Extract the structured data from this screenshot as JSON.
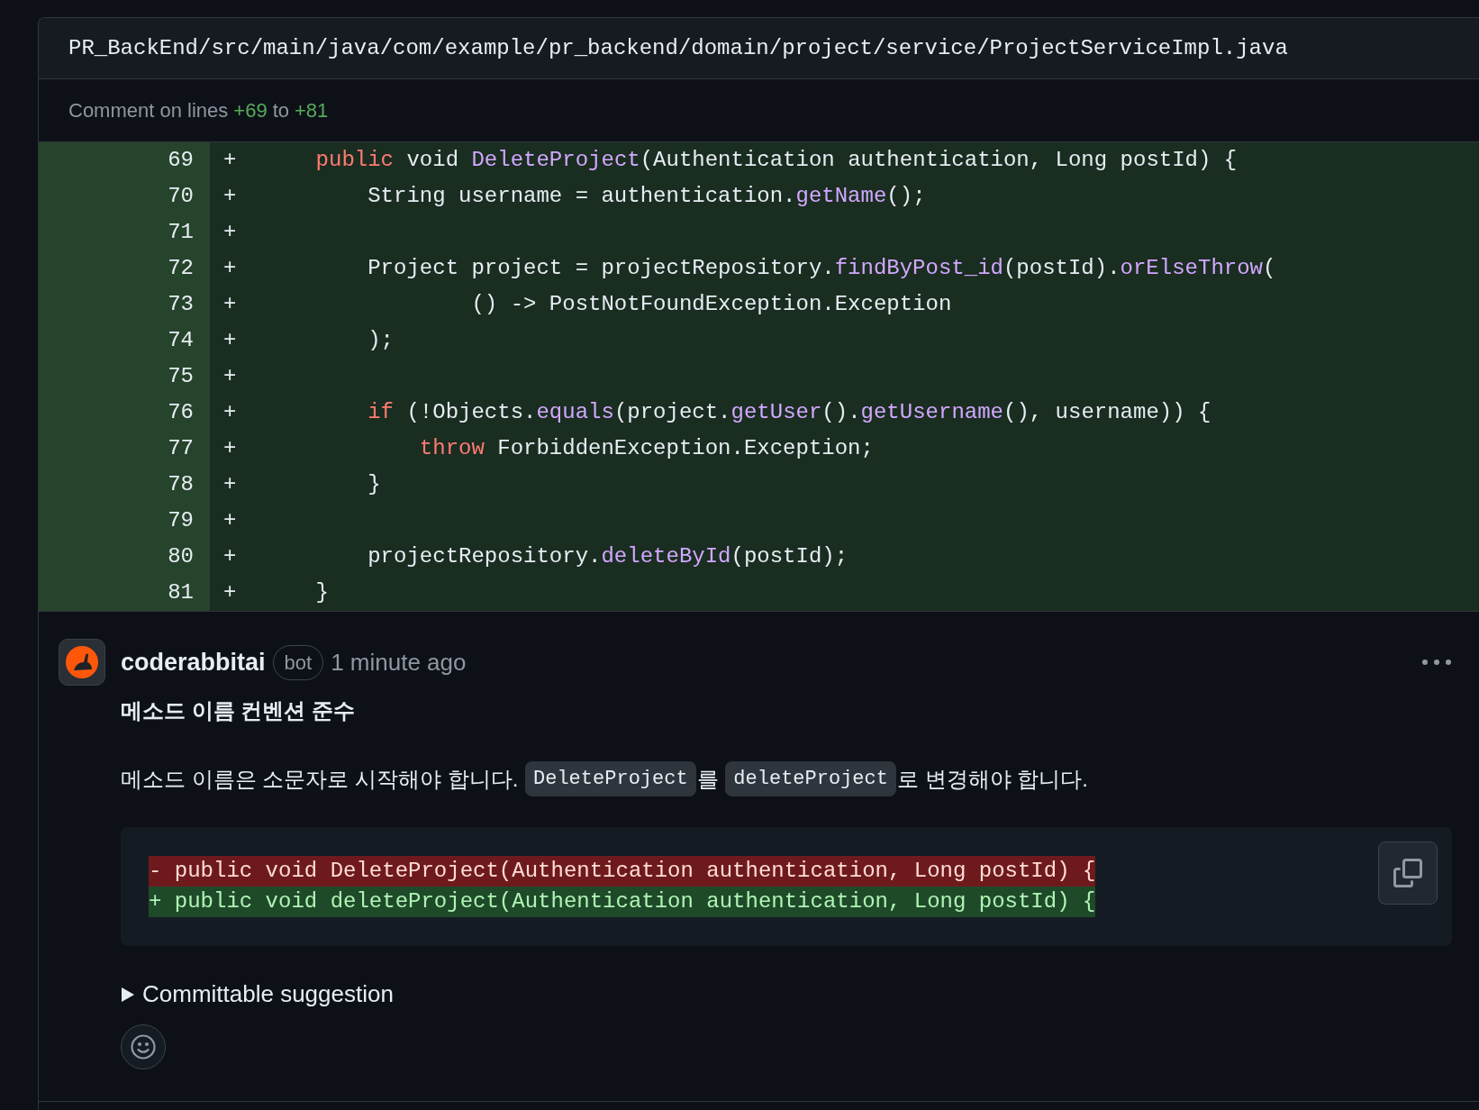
{
  "file": {
    "path": "PR_BackEnd/src/main/java/com/example/pr_backend/domain/project/service/ProjectServiceImpl.java"
  },
  "comment_range": {
    "prefix": "Comment on lines",
    "start": "+69",
    "middle": "to",
    "end": "+81"
  },
  "diff_lines": [
    {
      "number": "69",
      "sign": "+",
      "tokens": [
        {
          "kind": "keyword",
          "text": "    public"
        },
        {
          "kind": "plain",
          "text": " void "
        },
        {
          "kind": "function",
          "text": "DeleteProject"
        },
        {
          "kind": "plain",
          "text": "(Authentication authentication, Long postId) {"
        }
      ]
    },
    {
      "number": "70",
      "sign": "+",
      "tokens": [
        {
          "kind": "plain",
          "text": "        String username = authentication."
        },
        {
          "kind": "function",
          "text": "getName"
        },
        {
          "kind": "plain",
          "text": "();"
        }
      ]
    },
    {
      "number": "71",
      "sign": "+"
    },
    {
      "number": "72",
      "sign": "+",
      "tokens": [
        {
          "kind": "plain",
          "text": "        Project project = projectRepository."
        },
        {
          "kind": "function",
          "text": "findByPost_id"
        },
        {
          "kind": "plain",
          "text": "(postId)."
        },
        {
          "kind": "function",
          "text": "orElseThrow"
        },
        {
          "kind": "plain",
          "text": "("
        }
      ]
    },
    {
      "number": "73",
      "sign": "+",
      "tokens": [
        {
          "kind": "plain",
          "text": "                () -> PostNotFoundException.Exception"
        }
      ]
    },
    {
      "number": "74",
      "sign": "+",
      "tokens": [
        {
          "kind": "plain",
          "text": "        );"
        }
      ]
    },
    {
      "number": "75",
      "sign": "+"
    },
    {
      "number": "76",
      "sign": "+",
      "tokens": [
        {
          "kind": "keyword",
          "text": "        if"
        },
        {
          "kind": "plain",
          "text": " (!Objects."
        },
        {
          "kind": "function",
          "text": "equals"
        },
        {
          "kind": "plain",
          "text": "(project."
        },
        {
          "kind": "function",
          "text": "getUser"
        },
        {
          "kind": "plain",
          "text": "()."
        },
        {
          "kind": "function",
          "text": "getUsername"
        },
        {
          "kind": "plain",
          "text": "(), username)) {"
        }
      ]
    },
    {
      "number": "77",
      "sign": "+",
      "tokens": [
        {
          "kind": "keyword",
          "text": "            throw"
        },
        {
          "kind": "plain",
          "text": " ForbiddenException.Exception;"
        }
      ]
    },
    {
      "number": "78",
      "sign": "+",
      "tokens": [
        {
          "kind": "plain",
          "text": "        }"
        }
      ]
    },
    {
      "number": "79",
      "sign": "+"
    },
    {
      "number": "80",
      "sign": "+",
      "tokens": [
        {
          "kind": "plain",
          "text": "        projectRepository."
        },
        {
          "kind": "function",
          "text": "deleteById"
        },
        {
          "kind": "plain",
          "text": "(postId);"
        }
      ]
    },
    {
      "number": "81",
      "sign": "+",
      "tokens": [
        {
          "kind": "plain",
          "text": "    }"
        }
      ]
    }
  ],
  "comment": {
    "author": "coderabbitai",
    "badge": "bot",
    "time": "1 minute ago",
    "title": "메소드 이름 컨벤션 준수",
    "body": [
      {
        "kind": "text",
        "text": "메소드 이름은 소문자로 시작해야 합니다. "
      },
      {
        "kind": "code",
        "text": "DeleteProject"
      },
      {
        "kind": "text",
        "text": "를 "
      },
      {
        "kind": "code",
        "text": "deleteProject"
      },
      {
        "kind": "text",
        "text": "로 변경해야 합니다."
      }
    ],
    "suggestion": [
      {
        "kind": "removed",
        "text": "- public void DeleteProject(Authentication authentication, Long postId) {"
      },
      {
        "kind": "added",
        "text": "+ public void deleteProject(Authentication authentication, Long postId) {"
      }
    ],
    "details": {
      "summary": "Committable suggestion",
      "expanded": false
    }
  }
}
